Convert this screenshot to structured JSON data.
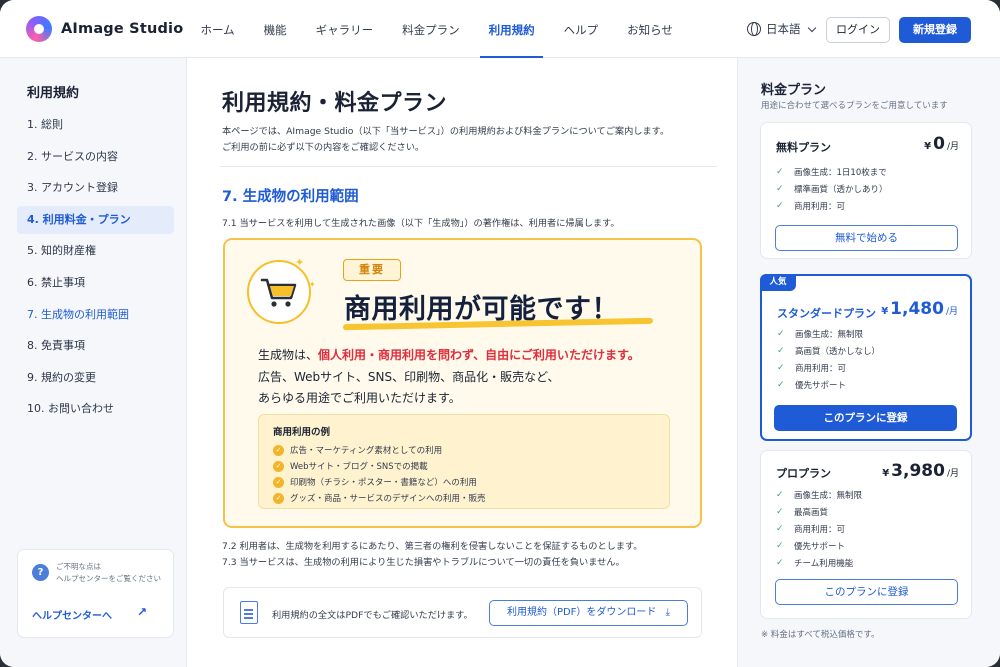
{
  "header": {
    "logo_text": "AImage Studio",
    "nav": [
      "ホーム",
      "機能",
      "ギャラリー",
      "料金プラン",
      "利用規約",
      "ヘルプ",
      "お知らせ"
    ],
    "active_nav": "利用規約",
    "language": "日本語",
    "login_label": "ログイン",
    "signup_label": "新規登録"
  },
  "sidebar": {
    "title": "利用規約",
    "items": [
      {
        "label": "1. 総則"
      },
      {
        "label": "2. サービスの内容"
      },
      {
        "label": "3. アカウント登録"
      },
      {
        "label": "4. 利用料金・プラン"
      },
      {
        "label": "5. 知的財産権"
      },
      {
        "label": "6. 禁止事項"
      },
      {
        "label": "7. 生成物の利用範囲"
      },
      {
        "label": "8. 免責事項"
      },
      {
        "label": "9. 規約の変更"
      },
      {
        "label": "10. お問い合わせ"
      }
    ],
    "help": {
      "line1": "ご不明な点は",
      "line2": "ヘルプセンターをご覧ください",
      "link": "ヘルプセンターへ"
    }
  },
  "main": {
    "title": "利用規約・料金プラン",
    "intro_line1": "本ページでは、AImage Studio（以下「当サービス」）の利用規約および料金プランについてご案内します。",
    "intro_line2": "ご利用の前に必ず以下の内容をご確認ください。",
    "section_title": "7. 生成物の利用範囲",
    "p71": "7.1  当サービスを利用して生成された画像（以下「生成物」）の著作権は、利用者に帰属します。",
    "callout": {
      "badge": "重要",
      "headline": "商用利用が可能です！",
      "lead_pre": "生成物は、",
      "lead_highlight": "個人利用・商用利用を問わず、自由にご利用いただけます。",
      "lead_line2": "広告、Webサイト、SNS、印刷物、商品化・販売など、",
      "lead_line3": "あらゆる用途でご利用いただけます。",
      "examples_title": "商用利用の例",
      "examples": [
        "広告・マーケティング素材としての利用",
        "Webサイト・ブログ・SNSでの掲載",
        "印刷物（チラシ・ポスター・書籍など）への利用",
        "グッズ・商品・サービスのデザインへの利用・販売"
      ]
    },
    "p72": "7.2  利用者は、生成物を利用するにあたり、第三者の権利を侵害しないことを保証するものとします。",
    "p73": "7.3  当サービスは、生成物の利用により生じた損害やトラブルについて一切の責任を負いません。",
    "pdf_text": "利用規約の全文はPDFでもご確認いただけます。",
    "pdf_button": "利用規約（PDF）をダウンロード"
  },
  "pricing": {
    "title": "料金プラン",
    "subtitle": "用途に合わせて選べるプランをご用意しています",
    "plans": [
      {
        "name": "無料プラン",
        "yen": "¥",
        "price": "0",
        "unit": "/月",
        "features": [
          "画像生成：1日10枚まで",
          "標準画質（透かしあり）",
          "商用利用：可"
        ],
        "button": "無料で始める"
      },
      {
        "badge": "人気",
        "name": "スタンダードプラン",
        "yen": "¥",
        "price": "1,480",
        "unit": "/月",
        "features": [
          "画像生成：無制限",
          "高画質（透かしなし）",
          "商用利用：可",
          "優先サポート"
        ],
        "button": "このプランに登録"
      },
      {
        "name": "プロプラン",
        "yen": "¥",
        "price": "3,980",
        "unit": "/月",
        "features": [
          "画像生成：無制限",
          "最高画質",
          "商用利用：可",
          "優先サポート",
          "チーム利用機能"
        ],
        "button": "このプランに登録"
      }
    ],
    "note": "※ 料金はすべて税込価格です。"
  },
  "colors": {
    "accent": "#1f5bd6",
    "highlight": "#e02d3c",
    "callout_border": "#f5c24a",
    "check_green": "#3aa67a"
  }
}
